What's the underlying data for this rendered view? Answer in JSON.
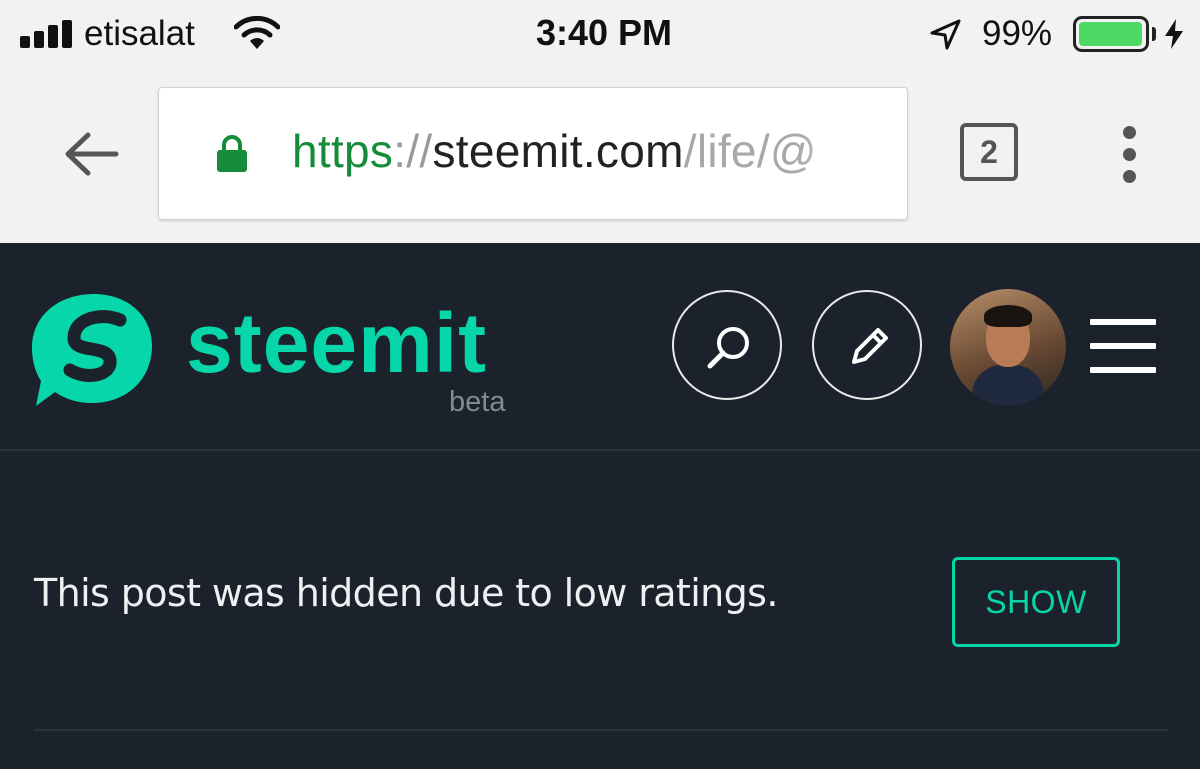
{
  "status_bar": {
    "carrier": "etisalat",
    "time": "3:40 PM",
    "battery_percent": "99%",
    "battery_level": 0.99,
    "icons": [
      "signal-icon",
      "wifi-icon",
      "location-arrow-icon",
      "battery-icon",
      "charging-bolt-icon"
    ]
  },
  "browser": {
    "url": {
      "scheme": "https",
      "separator": "://",
      "host": "steemit.com",
      "path": "/life/@"
    },
    "tab_count": "2",
    "icons": [
      "back-arrow-icon",
      "lock-icon",
      "overflow-menu-icon"
    ]
  },
  "site": {
    "brand": "steemit",
    "beta_label": "beta",
    "icons": [
      "steemit-logo-icon",
      "search-icon",
      "pencil-icon",
      "hamburger-menu-icon"
    ],
    "colors": {
      "accent": "#06d6a9",
      "background": "#1b222b"
    }
  },
  "post": {
    "hidden_message": "This post was hidden due to low ratings.",
    "show_label": "SHOW"
  }
}
